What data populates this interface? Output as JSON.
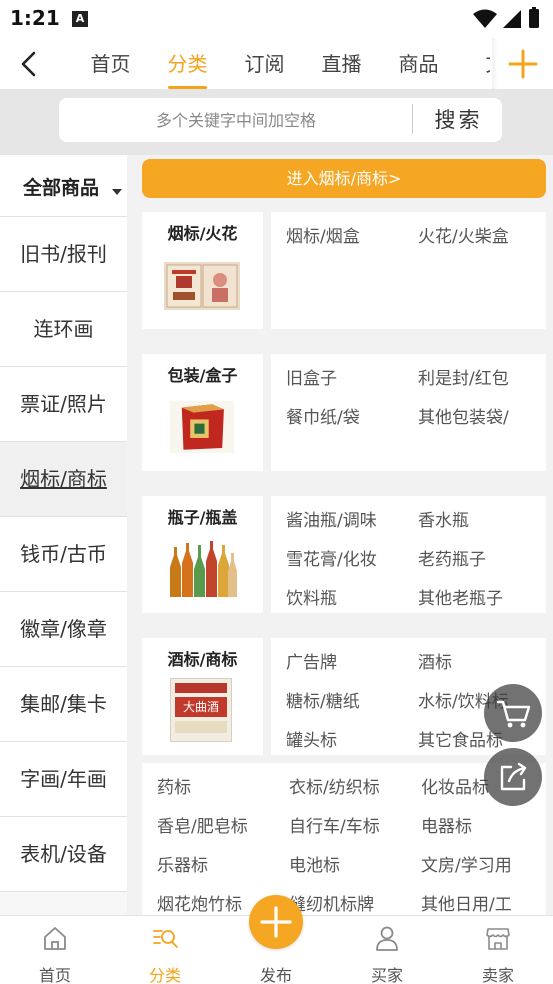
{
  "status_bar": {
    "time": "1:21",
    "notification_letter": "A"
  },
  "top_nav": {
    "tabs": [
      {
        "label": "首页"
      },
      {
        "label": "分类",
        "active": true
      },
      {
        "label": "订阅"
      },
      {
        "label": "直播"
      },
      {
        "label": "商品"
      },
      {
        "label": "文"
      }
    ]
  },
  "search": {
    "placeholder": "多个关键字中间加空格",
    "button_label": "搜索"
  },
  "sidebar": {
    "all_label": "全部商品",
    "items": [
      {
        "label": "旧书/报刊"
      },
      {
        "label": "连环画"
      },
      {
        "label": "票证/照片"
      },
      {
        "label": "烟标/商标",
        "active": true
      },
      {
        "label": "钱币/古币"
      },
      {
        "label": "徽章/像章"
      },
      {
        "label": "集邮/集卡"
      },
      {
        "label": "字画/年画"
      },
      {
        "label": "表机/设备"
      }
    ]
  },
  "main": {
    "enter_button": "进入烟标/商标>",
    "categories": [
      {
        "title": "烟标/火花",
        "image": "cigarette-label-image",
        "subs": [
          "烟标/烟盒",
          "火花/火柴盒"
        ]
      },
      {
        "title": "包装/盒子",
        "image": "tin-box-image",
        "subs": [
          "旧盒子",
          "利是封/红包",
          "餐巾纸/袋",
          "其他包装袋/"
        ]
      },
      {
        "title": "瓶子/瓶盖",
        "image": "glass-bottles-image",
        "subs": [
          "酱油瓶/调味",
          "香水瓶",
          "雪花膏/化妆",
          "老药瓶子",
          "饮料瓶",
          "其他老瓶子"
        ]
      },
      {
        "title": "酒标/商标",
        "image": "liquor-label-image",
        "image_text": "大曲酒",
        "subs": [
          "广告牌",
          "酒标",
          "糖标/糖纸",
          "水标/饮料标",
          "罐头标",
          "其它食品标"
        ]
      }
    ],
    "extra_subs": [
      "药标",
      "衣标/纺织标",
      "化妆品标",
      "香皂/肥皂标",
      "自行车/车标",
      "电器标",
      "乐器标",
      "电池标",
      "文房/学习用",
      "烟花炮竹标",
      "缝纫机标牌",
      "其他日用/工"
    ]
  },
  "bottom_nav": {
    "items": [
      {
        "label": "首页",
        "icon": "home-icon"
      },
      {
        "label": "分类",
        "icon": "category-search-icon",
        "active": true
      },
      {
        "label": "发布",
        "icon": "plus-icon"
      },
      {
        "label": "买家",
        "icon": "person-icon"
      },
      {
        "label": "卖家",
        "icon": "shop-icon"
      }
    ]
  },
  "colors": {
    "accent": "#f5a623",
    "active_tab": "#f5a31a"
  }
}
